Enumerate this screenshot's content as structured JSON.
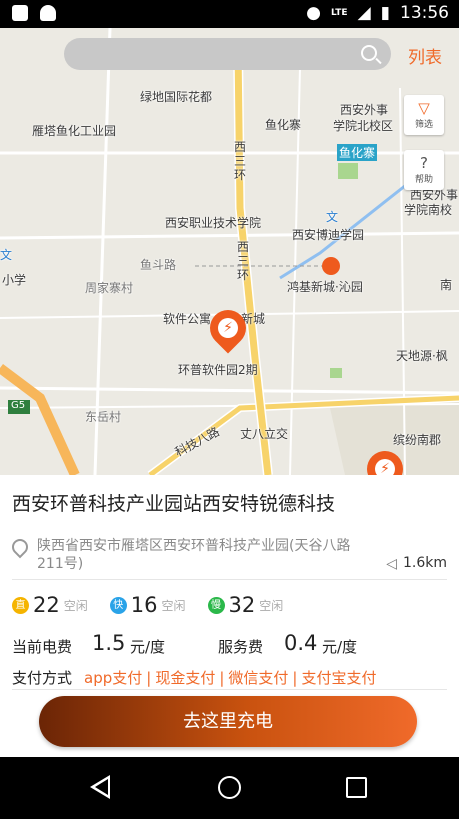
{
  "status_bar": {
    "time": "13:56",
    "network": "LTE"
  },
  "search": {
    "placeholder": ""
  },
  "header": {
    "list_label": "列表"
  },
  "map_controls": {
    "filter_label": "筛选",
    "help_label": "帮助"
  },
  "map_labels": [
    "绿地国际花都",
    "西安外事",
    "学院北校区",
    "雁塔鱼化工业园",
    "鱼化寨",
    "鱼化寨",
    "西安外事",
    "学院南校",
    "西安职业技术学院",
    "西安博迪学园",
    "鱼斗路",
    "周家寨村",
    "鸿基新城·沁园",
    "小学",
    "软件公寓",
    "新城",
    "环普软件园2期",
    "天地源·枫",
    "东岳村",
    "科技八路",
    "丈八立交",
    "缤纷南郡",
    "南",
    "G5",
    "西三环",
    "西三环",
    "文",
    "文"
  ],
  "station": {
    "name": "西安环普科技产业园站西安特锐德科技",
    "address": "陕西省西安市雁塔区西安环普科技产业园(天谷八路211号)",
    "distance": "1.6km",
    "counts": [
      {
        "badge": "直",
        "value": "22",
        "label": "空闲",
        "color": "#f5b400"
      },
      {
        "badge": "快",
        "value": "16",
        "label": "空闲",
        "color": "#2aa3e8"
      },
      {
        "badge": "慢",
        "value": "32",
        "label": "空闲",
        "color": "#2bb84a"
      }
    ],
    "current_fee_label": "当前电费",
    "current_fee_value": "1.5",
    "current_fee_unit": "元/度",
    "service_fee_label": "服务费",
    "service_fee_value": "0.4",
    "service_fee_unit": "元/度",
    "payment_label": "支付方式",
    "payment_methods": [
      "app支付",
      "现金支付",
      "微信支付",
      "支付宝支付"
    ],
    "payment_separator": "|"
  },
  "action": {
    "charge_button": "去这里充电"
  }
}
